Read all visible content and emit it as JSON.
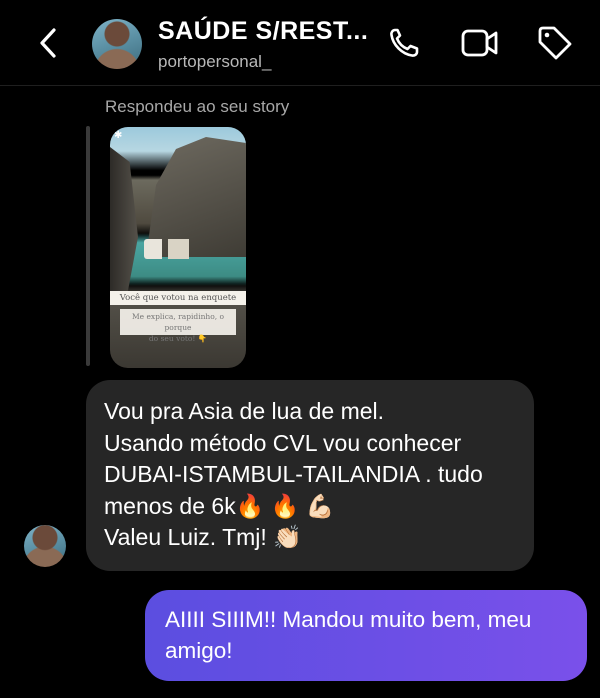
{
  "header": {
    "title": "SAÚDE S/REST...",
    "username": "portopersonal_"
  },
  "story_reply": {
    "label": "Respondeu ao seu story",
    "poll_question": "Você que votou na enquete",
    "poll_prompt_line1": "Me explica, rapidinho, o porque",
    "poll_prompt_line2": "do seu voto! 👇"
  },
  "messages": [
    {
      "sender": "contact",
      "lines": [
        "Vou pra Asia de lua de mel.",
        "Usando método CVL vou conhecer",
        "DUBAI-ISTAMBUL-TAILANDIA . tudo",
        "menos de 6k🔥 🔥 💪🏻",
        "Valeu Luiz. Tmj! 👏🏻"
      ]
    },
    {
      "sender": "me",
      "lines": [
        "AIIII SIIIM!! Mandou muito bem, meu",
        "amigo!"
      ]
    }
  ]
}
